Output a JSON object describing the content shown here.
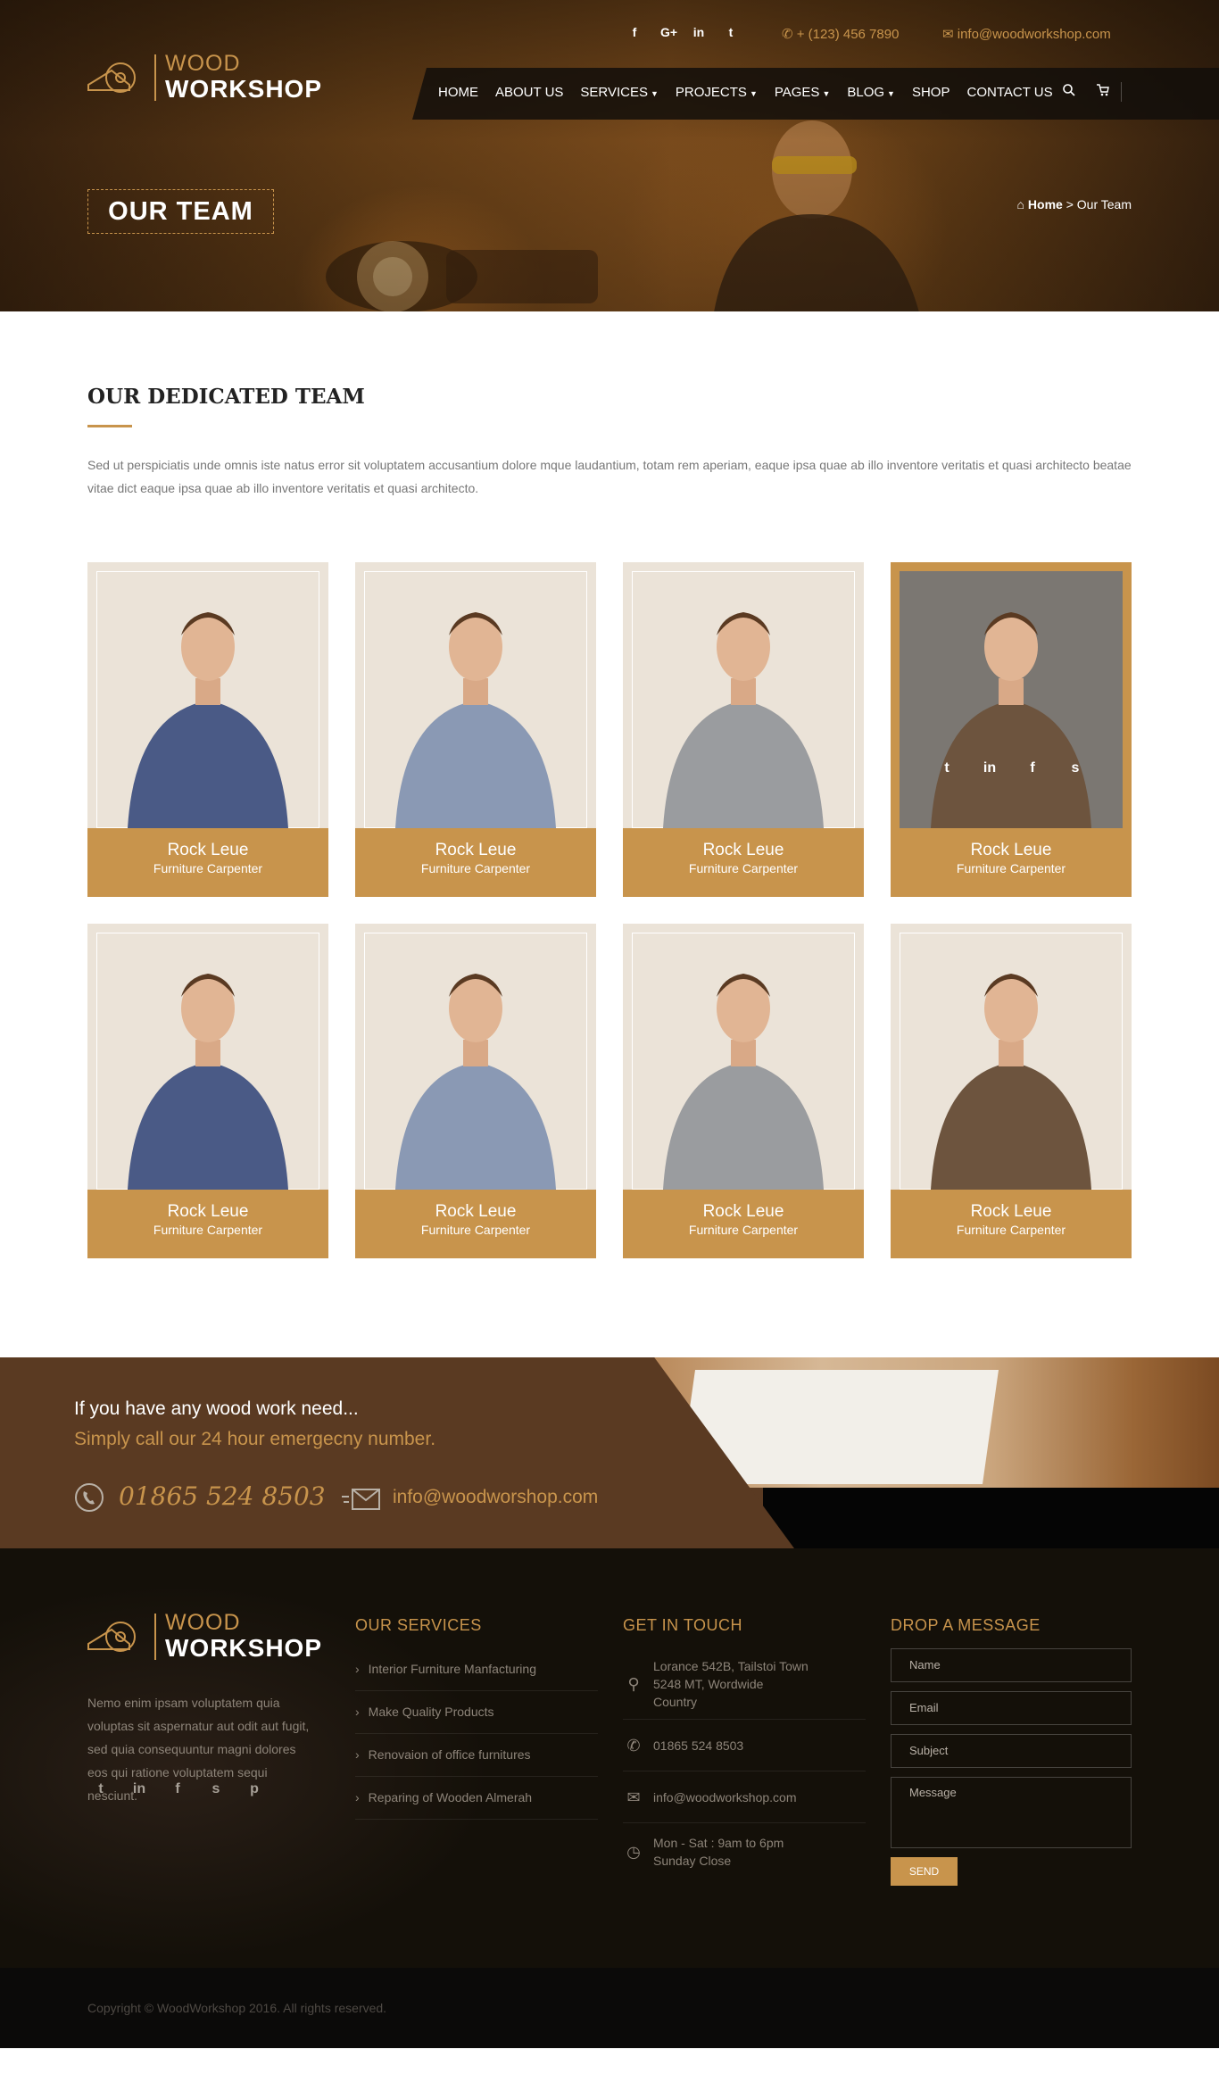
{
  "header": {
    "social": [
      "f",
      "G+",
      "in",
      "t"
    ],
    "phone": "+ (123) 456 7890",
    "email": "info@woodworkshop.com",
    "logo": {
      "line1": "WOOD",
      "line2": "WORKSHOP"
    },
    "nav": [
      {
        "label": "HOME",
        "dropdown": false
      },
      {
        "label": "ABOUT US",
        "dropdown": false
      },
      {
        "label": "SERVICES",
        "dropdown": true
      },
      {
        "label": "PROJECTS",
        "dropdown": true
      },
      {
        "label": "PAGES",
        "dropdown": true
      },
      {
        "label": "BLOG",
        "dropdown": true
      },
      {
        "label": "SHOP",
        "dropdown": false
      },
      {
        "label": "CONTACT US",
        "dropdown": false
      }
    ],
    "page_title": "OUR TEAM",
    "breadcrumb": {
      "home": "Home",
      "separator": ">",
      "current": "Our Team"
    }
  },
  "intro": {
    "title": "OUR DEDICATED TEAM",
    "text": "Sed ut perspiciatis unde omnis iste natus error sit voluptatem accusantium dolore mque laudantium, totam rem aperiam, eaque ipsa quae ab illo inventore veritatis et quasi architecto beatae vitae dict eaque ipsa quae ab illo inventore veritatis et quasi architecto."
  },
  "team": [
    {
      "name": "Rock Leue",
      "role": "Furniture Carpenter",
      "shirt": "#4a5a86",
      "active": false
    },
    {
      "name": "Rock Leue",
      "role": "Furniture Carpenter",
      "shirt": "#8a99b4",
      "active": false
    },
    {
      "name": "Rock Leue",
      "role": "Furniture Carpenter",
      "shirt": "#9a9c9f",
      "active": false
    },
    {
      "name": "Rock Leue",
      "role": "Furniture Carpenter",
      "shirt": "#6d543e",
      "active": true
    },
    {
      "name": "Rock Leue",
      "role": "Furniture Carpenter",
      "shirt": "#4a5a86",
      "active": false
    },
    {
      "name": "Rock Leue",
      "role": "Furniture Carpenter",
      "shirt": "#8a99b4",
      "active": false
    },
    {
      "name": "Rock Leue",
      "role": "Furniture Carpenter",
      "shirt": "#9a9c9f",
      "active": false
    },
    {
      "name": "Rock Leue",
      "role": "Furniture Carpenter",
      "shirt": "#6d543e",
      "active": false
    }
  ],
  "card_social": [
    "t",
    "in",
    "f",
    "s"
  ],
  "cta": {
    "line1": "If you have any wood work need...",
    "line2": "Simply call our 24 hour emergecny number.",
    "phone": "01865 524 8503",
    "email": "info@woodworshop.com"
  },
  "footer": {
    "logo": {
      "line1": "WOOD",
      "line2": "WORKSHOP"
    },
    "about": "Nemo enim ipsam voluptatem quia voluptas sit aspernatur aut odit aut fugit, sed quia consequuntur magni dolores eos qui ratione voluptatem sequi nesciunt.",
    "social": [
      "t",
      "in",
      "f",
      "s",
      "p"
    ],
    "services_title": "OUR SERVICES",
    "services": [
      "Interior Furniture Manfacturing",
      "Make Quality Products",
      "Renovaion of office furnitures",
      "Reparing of Wooden Almerah"
    ],
    "contact_title": "GET IN TOUCH",
    "contact": {
      "address": [
        "Lorance 542B, Tailstoi Town",
        "5248 MT, Wordwide",
        "Country"
      ],
      "phone": "01865 524 8503",
      "email": "info@woodworkshop.com",
      "hours": [
        "Mon - Sat : 9am to 6pm",
        "Sunday Close"
      ]
    },
    "form_title": "DROP A MESSAGE",
    "form": {
      "name": "Name",
      "email": "Email",
      "subject": "Subject",
      "message": "Message",
      "send": "SEND"
    },
    "copyright": "Copyright © WoodWorkshop 2016. All rights reserved."
  },
  "colors": {
    "accent": "#c8944c",
    "cta_bg": "#5a3a22",
    "footer_bg": "#141009"
  }
}
